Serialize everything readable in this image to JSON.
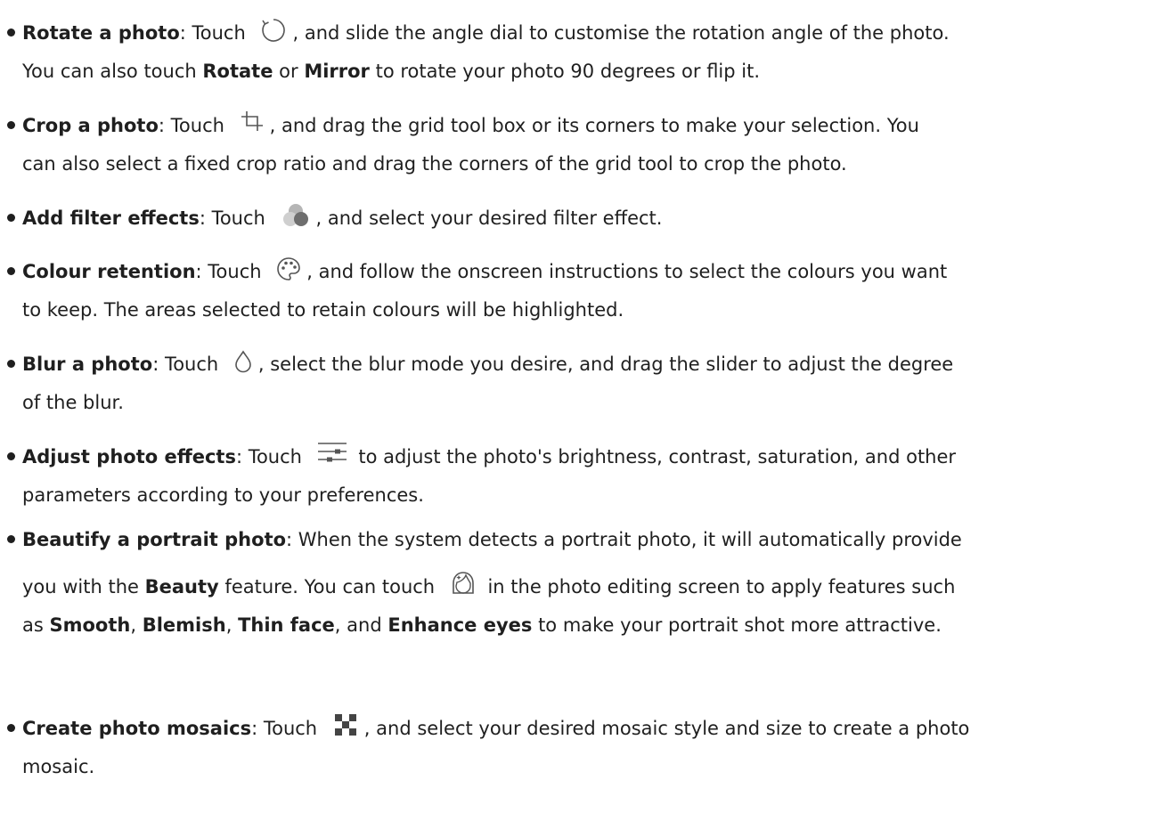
{
  "items": [
    {
      "title": "Rotate a photo",
      "l1_a": ": Touch ",
      "icon": "rotate-icon",
      "l1_b": ", and slide the angle dial to customise the rotation angle of the photo.",
      "l2_a": "You can also touch ",
      "l2_b1": "Rotate",
      "l2_c": " or ",
      "l2_b2": "Mirror",
      "l2_d": " to rotate your photo 90 degrees or flip it."
    },
    {
      "title": "Crop a photo",
      "l1_a": ": Touch ",
      "icon": "crop-icon",
      "l1_b": ", and drag the grid tool box or its corners to make your selection. You",
      "l2": "can also select a fixed crop ratio and drag the corners of the grid tool to crop the photo."
    },
    {
      "title": "Add filter effects",
      "l1_a": ": Touch ",
      "icon": "filter-icon",
      "l1_b": ", and select your desired filter effect."
    },
    {
      "title": "Colour retention",
      "l1_a": ": Touch ",
      "icon": "palette-icon",
      "l1_b": ", and follow the onscreen instructions to select the colours you want",
      "l2": "to keep. The areas selected to retain colours will be highlighted."
    },
    {
      "title": "Blur a photo",
      "l1_a": ": Touch ",
      "icon": "blur-drop-icon",
      "l1_b": ", select the blur mode you desire, and drag the slider to adjust the degree",
      "l2": "of the blur."
    },
    {
      "title": "Adjust photo effects",
      "l1_a": ": Touch ",
      "icon": "adjust-sliders-icon",
      "l1_b": " to adjust the photo's brightness, contrast, saturation, and other",
      "l2": "parameters according to your preferences."
    },
    {
      "title": "Beautify a portrait photo",
      "l1_a": ": When the system detects a portrait photo, it will automatically provide",
      "l2_a": "you with the ",
      "l2_b": "Beauty",
      "l2_c": " feature. You can touch ",
      "icon": "beauty-face-icon",
      "l2_d": " in the photo editing screen to apply features such",
      "l3_a": "as ",
      "l3_b1": "Smooth",
      "l3_s1": ", ",
      "l3_b2": "Blemish",
      "l3_s2": ", ",
      "l3_b3": "Thin face",
      "l3_s3": ", and ",
      "l3_b4": "Enhance eyes",
      "l3_c": " to make your portrait shot more attractive."
    },
    {
      "title": "Create photo mosaics",
      "l1_a": ": Touch ",
      "icon": "mosaic-icon",
      "l1_b": ", and select your desired mosaic style and size to create a photo",
      "l2": "mosaic."
    }
  ]
}
